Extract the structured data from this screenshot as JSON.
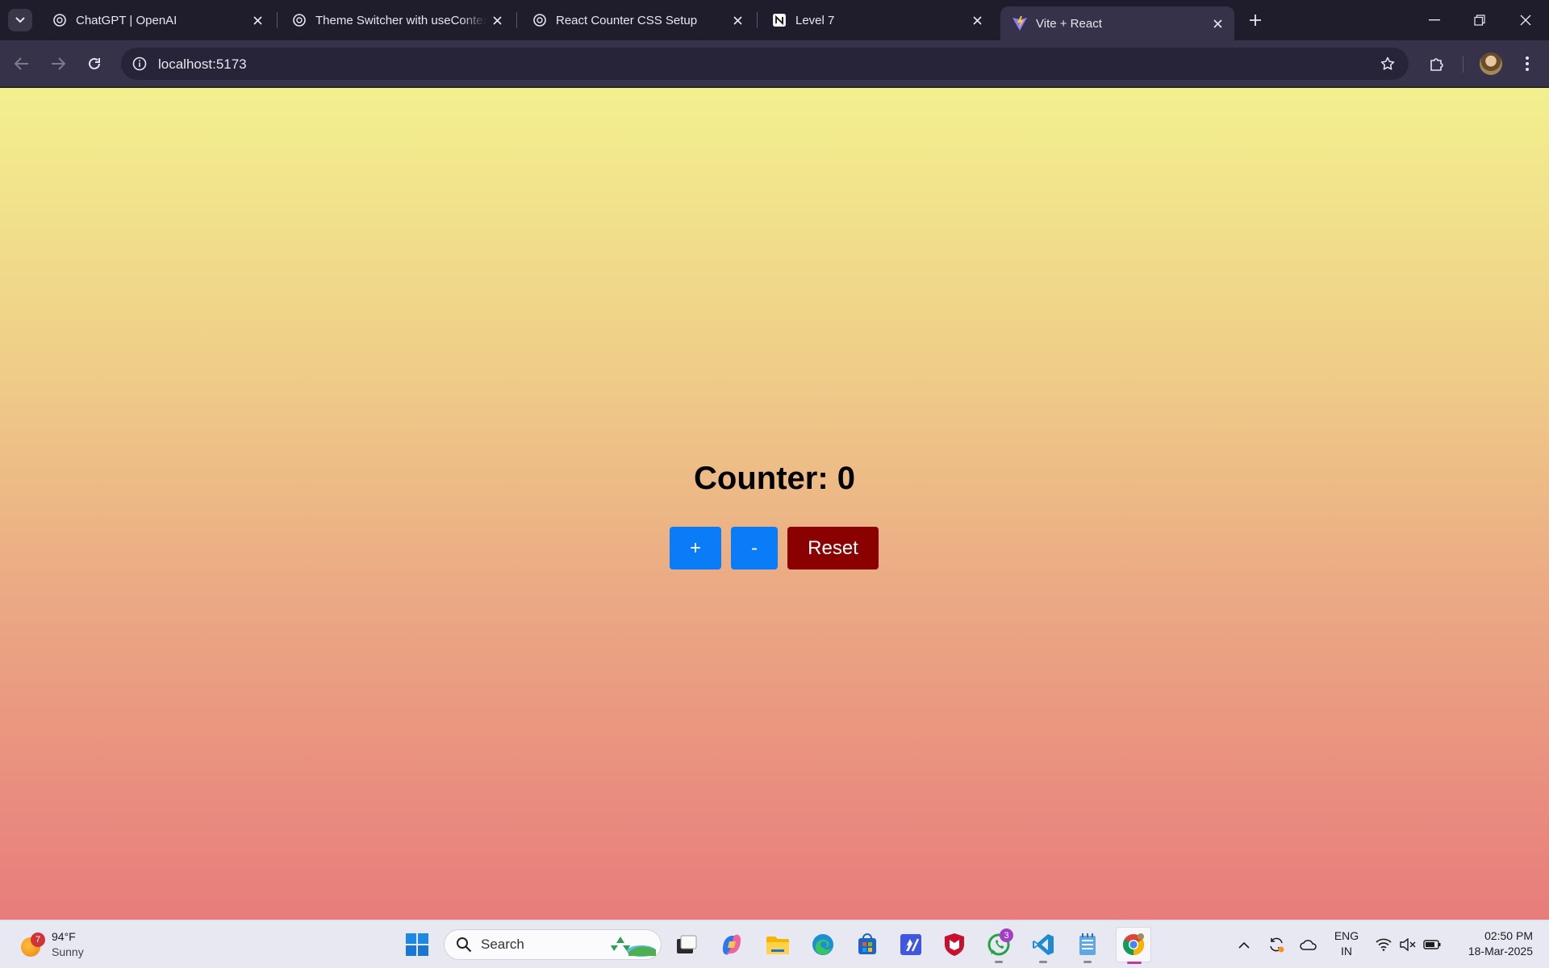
{
  "browser": {
    "tabs": [
      {
        "title": "ChatGPT | OpenAI",
        "icon": "openai-icon"
      },
      {
        "title": "Theme Switcher with useContext",
        "icon": "openai-icon"
      },
      {
        "title": "React Counter CSS Setup",
        "icon": "openai-icon"
      },
      {
        "title": "Level 7",
        "icon": "notion-icon"
      },
      {
        "title": "Vite + React",
        "icon": "vite-icon",
        "active": true
      }
    ],
    "address": "localhost:5173"
  },
  "page": {
    "heading": "Counter: 0",
    "buttons": {
      "increment": "+",
      "decrement": "-",
      "reset": "Reset"
    },
    "colors": {
      "increment_bg": "#0a7cf7",
      "reset_bg": "#8b0000",
      "gradient_top": "#f2f08e",
      "gradient_bottom": "#e87c7b"
    }
  },
  "taskbar": {
    "weather": {
      "temp": "94°F",
      "condition": "Sunny",
      "badge": "7"
    },
    "search_label": "Search",
    "whatsapp_badge": "3",
    "language": {
      "line1": "ENG",
      "line2": "IN"
    },
    "clock": {
      "time": "02:50 PM",
      "date": "18-Mar-2025"
    }
  }
}
